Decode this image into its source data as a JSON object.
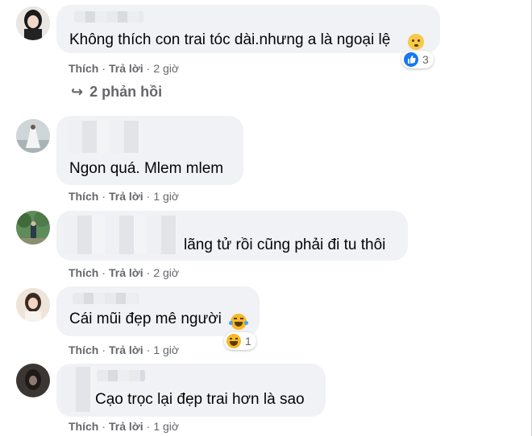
{
  "comments": [
    {
      "text": "Không thích con trai tóc dài.nhưng a là ngoại lệ",
      "like_label": "Thích",
      "reply_label": "Trả lời",
      "time": "2 giờ",
      "reactions": {
        "icon": "like-icon",
        "count": "3"
      },
      "emoji": "hushed-face-icon"
    },
    {
      "text": "Ngon quá. Mlem mlem",
      "like_label": "Thích",
      "reply_label": "Trả lời",
      "time": "1 giờ"
    },
    {
      "text": "lãng tử rồi cũng phải đi tu thôi",
      "like_label": "Thích",
      "reply_label": "Trả lời",
      "time": "2 giờ"
    },
    {
      "text": "Cái mũi đẹp mê người",
      "like_label": "Thích",
      "reply_label": "Trả lời",
      "time": "1 giờ",
      "reactions": {
        "icon": "haha-icon",
        "count": "1"
      },
      "emoji": "laughing-tears-icon"
    },
    {
      "text": "Cạo trọc lại đẹp trai hơn là sao",
      "like_label": "Thích",
      "reply_label": "Trả lời",
      "time": "1 giờ"
    }
  ],
  "replies_link": {
    "icon": "reply-arrow-icon",
    "label": "2 phản hồi"
  },
  "colors": {
    "bubble": "#f0f2f5",
    "meta": "#65676b",
    "like": "#1877f2",
    "haha": "#f7b928"
  }
}
